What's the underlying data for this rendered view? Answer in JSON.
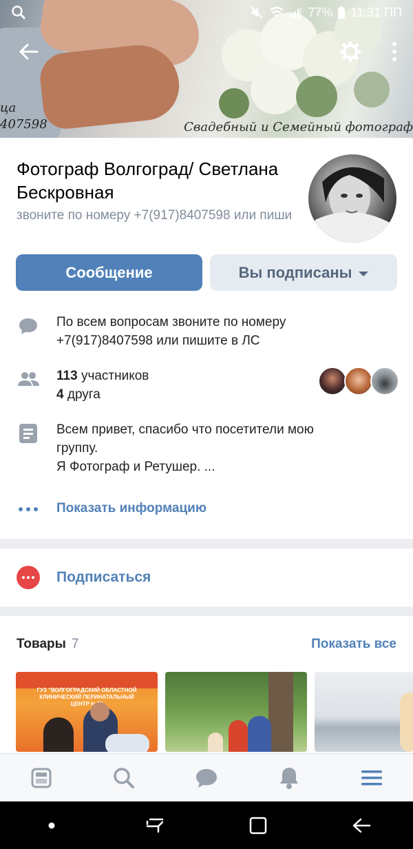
{
  "status_bar": {
    "battery": "77%",
    "time": "11:31 ПП"
  },
  "cover": {
    "caption": "Свадебный и Семейный фотограф",
    "left_fragment_1": "ца",
    "left_fragment_2": "407598"
  },
  "group": {
    "title": "Фотограф Волгоград/ Светлана Бескровная",
    "status": "звоните по номеру +7(917)8407598 или пишите в ЛС"
  },
  "actions": {
    "message_label": "Сообщение",
    "subscribed_label": "Вы подписаны"
  },
  "info": {
    "contact_text": "По всем вопросам звоните по номеру +7(917)8407598 или пишите в ЛС",
    "members_count": "113",
    "members_label": "участников",
    "friends_count": "4",
    "friends_label": "друга",
    "description": "Всем привет, спасибо что посетители мою группу.",
    "description_line2": "Я Фотограф  и Ретушер. ...",
    "show_info_label": "Показать информацию"
  },
  "subscribe": {
    "label": "Подписаться"
  },
  "goods": {
    "title": "Товары",
    "count": "7",
    "show_all_label": "Показать все",
    "item1_text": "ГУЗ \"ВОЛГОГРАДСКИЙ ОБЛАСТНОЙ КЛИНИЧЕСКИЙ ПЕРИНАТАЛЬНЫЙ ЦЕНТР №2\""
  },
  "tabs": [
    "news-icon",
    "search-icon",
    "messages-icon",
    "notifications-icon",
    "menu-icon"
  ],
  "colors": {
    "accent": "#5181b8",
    "secondary_button": "#e5ebf1",
    "subscribe_icon": "#e64646",
    "muted_text": "#818c99"
  }
}
